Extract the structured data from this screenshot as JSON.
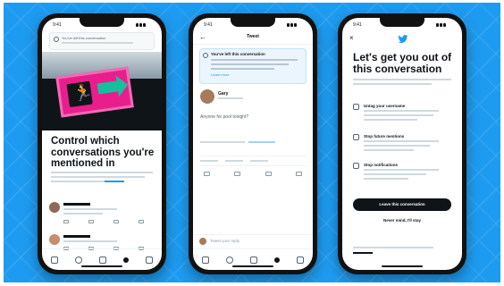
{
  "colors": {
    "background": "#1d9bf0",
    "text": "#0f1419",
    "link": "#1d9bf0",
    "sign": "#e91e8c",
    "arrow": "#17bf9e"
  },
  "phone1": {
    "status_time": "9:41",
    "banner_title": "You've left this conversation",
    "headline": "Control which conversations you're mentioned in",
    "tabs": [
      "home-icon",
      "search-icon",
      "bell-icon",
      "spaces-icon",
      "mail-icon"
    ]
  },
  "phone2": {
    "status_time": "9:41",
    "nav_title": "Tweet",
    "notice_title": "You've left this conversation",
    "notice_link": "Learn more",
    "author_name": "Gary",
    "tweet_text": "Anyone for pool tonight?",
    "reply_placeholder": "Tweet your reply",
    "tabs": [
      "home-icon",
      "search-icon",
      "bell-icon",
      "spaces-icon",
      "mail-icon"
    ]
  },
  "phone3": {
    "status_time": "9:41",
    "headline": "Let's get you out of this conversation",
    "options": [
      {
        "label": "Untag your username",
        "icon": "untag-icon"
      },
      {
        "label": "Stop future mentions",
        "icon": "block-mention-icon"
      },
      {
        "label": "Stop notifications",
        "icon": "bell-off-icon"
      }
    ],
    "leave_button": "Leave this conversation",
    "stay_button": "Never mind, I'll stay"
  }
}
